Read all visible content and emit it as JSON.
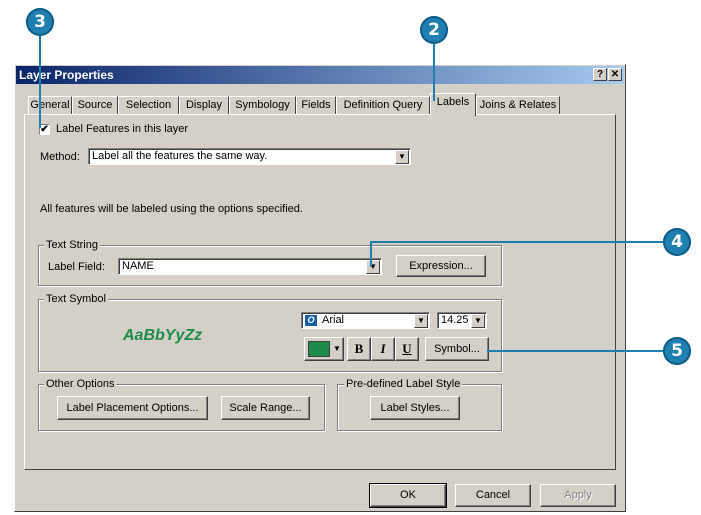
{
  "callouts": {
    "c3": "3",
    "c2": "2",
    "c4": "4",
    "c5": "5"
  },
  "window": {
    "title": "Layer Properties",
    "help_btn": "?",
    "close_btn": "✕"
  },
  "tabs": [
    {
      "label": "General"
    },
    {
      "label": "Source"
    },
    {
      "label": "Selection"
    },
    {
      "label": "Display"
    },
    {
      "label": "Symbology"
    },
    {
      "label": "Fields"
    },
    {
      "label": "Definition Query"
    },
    {
      "label": "Labels",
      "active": true
    },
    {
      "label": "Joins & Relates"
    }
  ],
  "labels_tab": {
    "label_features_checkbox": {
      "label": "Label Features in this layer",
      "checked": true,
      "mark": "✔"
    },
    "method_label": "Method:",
    "method_value": "Label all the features the same way.",
    "info_text": "All features will be labeled using the options specified.",
    "text_string": {
      "group_label": "Text String",
      "field_label": "Label Field:",
      "field_value": "NAME",
      "expression_button": "Expression..."
    },
    "text_symbol": {
      "group_label": "Text Symbol",
      "sample_text": "AaBbYyZz",
      "sample_color": "#1e8b4a",
      "font_value": "Arial",
      "font_icon": "O",
      "size_value": "14.25",
      "bold_label": "B",
      "italic_label": "I",
      "underline_label": "U",
      "symbol_button": "Symbol..."
    },
    "other_options": {
      "group_label": "Other Options",
      "placement_button": "Label Placement Options...",
      "scale_button": "Scale Range..."
    },
    "predefined": {
      "group_label": "Pre-defined Label Style",
      "styles_button": "Label Styles..."
    }
  },
  "footer": {
    "ok": "OK",
    "cancel": "Cancel",
    "apply": "Apply"
  },
  "icons": {
    "dropdown": "▼"
  },
  "colors": {
    "callout": "#1f7fb0",
    "title_start": "#0a246a",
    "title_end": "#a6caf0",
    "face": "#d4d0c8"
  }
}
